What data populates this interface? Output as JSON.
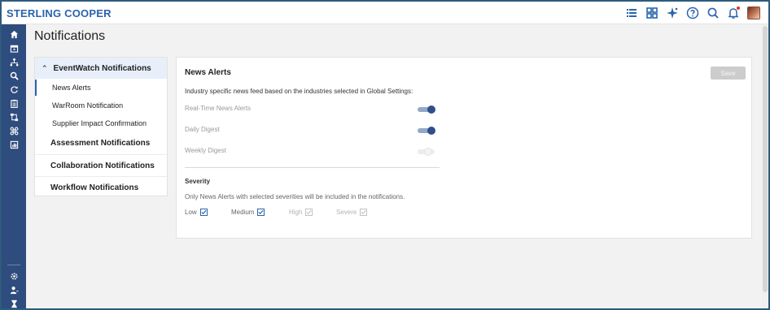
{
  "brand": "STERLING COOPER",
  "colors": {
    "accent": "#2a63ad",
    "sidebar": "#2f4c7e",
    "toggle_on": "#2f4f88"
  },
  "topbar": {
    "icons": [
      "list-icon",
      "grid-icon",
      "sparkle-icon",
      "help-icon",
      "search-icon",
      "bell-icon",
      "user-avatar"
    ]
  },
  "sidebar": {
    "icons": [
      "home-icon",
      "calendar-icon",
      "network-icon",
      "search-icon",
      "refresh-icon",
      "clipboard-icon",
      "workflow-icon",
      "command-icon",
      "report-icon",
      "settings-icon",
      "user-icon",
      "hourglass-icon"
    ]
  },
  "page": {
    "title": "Notifications"
  },
  "nav": {
    "group_label": "EventWatch Notifications",
    "sub_items": [
      "News Alerts",
      "WarRoom Notification",
      "Supplier Impact Confirmation"
    ],
    "categories": [
      "Assessment Notifications",
      "Collaboration Notifications",
      "Workflow Notifications"
    ]
  },
  "card": {
    "title": "News Alerts",
    "save_label": "Save",
    "description": "Industry specific news feed based on the industries selected in Global Settings:",
    "options": [
      {
        "label": "Real-Time News Alerts",
        "enabled": true
      },
      {
        "label": "Daily Digest",
        "enabled": true
      },
      {
        "label": "Weekly Digest",
        "enabled": false
      }
    ],
    "severity": {
      "title": "Severity",
      "description": "Only News Alerts with selected severities will be included in the notifications.",
      "items": [
        {
          "label": "Low",
          "checked": true
        },
        {
          "label": "Medium",
          "checked": true
        },
        {
          "label": "High",
          "checked": false
        },
        {
          "label": "Severe",
          "checked": false
        }
      ]
    }
  }
}
